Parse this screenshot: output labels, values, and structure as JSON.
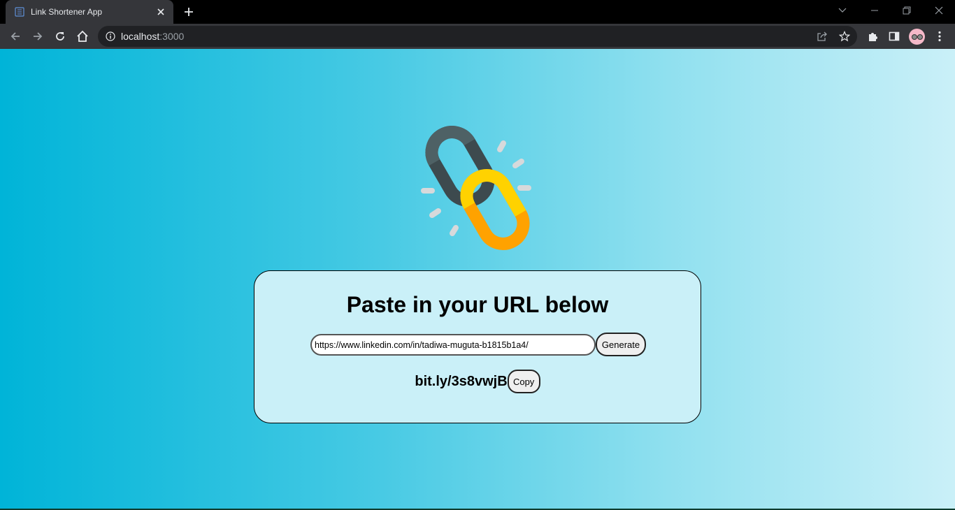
{
  "browser": {
    "tab_title": "Link Shortener App",
    "url_host": "localhost",
    "url_port": ":3000"
  },
  "page": {
    "heading": "Paste in your URL below",
    "url_input_value": "https://www.linkedin.com/in/tadiwa-muguta-b1815b1a4/",
    "generate_label": "Generate",
    "short_link": "bit.ly/3s8vwjB",
    "copy_label": "Copy"
  },
  "colors": {
    "gradient_start": "#00b4d8",
    "gradient_end": "#caf0f8",
    "card_background": "#caf0f8",
    "chain_dark": "#3d4a4e",
    "chain_yellow": "#ffd200",
    "chain_orange": "#ffa200"
  },
  "icons": [
    "tab-favicon-icon",
    "close-icon",
    "plus-icon",
    "chevron-down-icon",
    "minimize-icon",
    "restore-icon",
    "window-close-icon",
    "back-arrow-icon",
    "forward-arrow-icon",
    "reload-icon",
    "home-icon",
    "info-icon",
    "share-icon",
    "star-icon",
    "extensions-icon",
    "side-panel-icon",
    "profile-avatar-icon",
    "menu-dots-icon",
    "broken-chain-link-icon"
  ]
}
